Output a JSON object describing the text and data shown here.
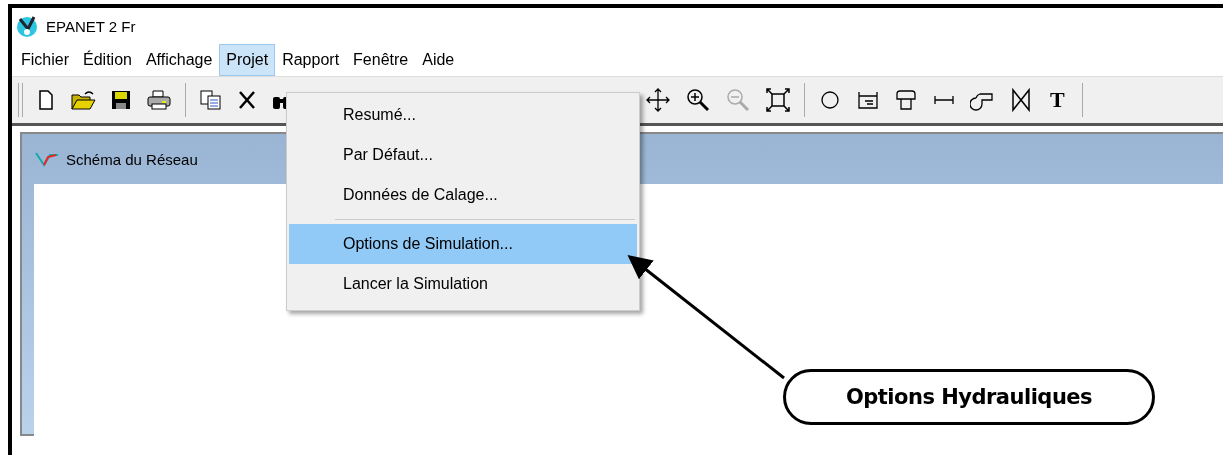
{
  "window": {
    "title": "EPANET 2 Fr"
  },
  "menu_bar": [
    {
      "label": "Fichier",
      "selected": false
    },
    {
      "label": "Édition",
      "selected": false
    },
    {
      "label": "Affichage",
      "selected": false
    },
    {
      "label": "Projet",
      "selected": true
    },
    {
      "label": "Rapport",
      "selected": false
    },
    {
      "label": "Fenêtre",
      "selected": false
    },
    {
      "label": "Aide",
      "selected": false
    }
  ],
  "toolbar": [
    {
      "kind": "new",
      "disabled": false
    },
    {
      "kind": "open",
      "disabled": false
    },
    {
      "kind": "save",
      "disabled": false
    },
    {
      "kind": "print",
      "disabled": false
    },
    {
      "kind": "sep"
    },
    {
      "kind": "copy",
      "disabled": false
    },
    {
      "kind": "delete",
      "disabled": false
    },
    {
      "kind": "find",
      "disabled": false
    },
    {
      "kind": "gap"
    },
    {
      "kind": "pan",
      "disabled": false
    },
    {
      "kind": "zoomin",
      "disabled": false
    },
    {
      "kind": "zoomout",
      "disabled": true
    },
    {
      "kind": "extent",
      "disabled": false
    },
    {
      "kind": "sep"
    },
    {
      "kind": "junction",
      "disabled": false
    },
    {
      "kind": "reservoir",
      "disabled": false
    },
    {
      "kind": "tank",
      "disabled": false
    },
    {
      "kind": "pipe",
      "disabled": false
    },
    {
      "kind": "pump",
      "disabled": false
    },
    {
      "kind": "valve",
      "disabled": false
    },
    {
      "kind": "label",
      "text": "T",
      "disabled": false
    }
  ],
  "child_window": {
    "title": "Schéma du Réseau"
  },
  "dropdown": [
    {
      "kind": "item",
      "label": "Resumé...",
      "selected": false
    },
    {
      "kind": "item",
      "label": "Par Défaut...",
      "selected": false
    },
    {
      "kind": "item",
      "label": "Données de Calage...",
      "selected": false
    },
    {
      "kind": "separator"
    },
    {
      "kind": "item",
      "label": "Options de Simulation...",
      "selected": true
    },
    {
      "kind": "item",
      "label": "Lancer la Simulation",
      "selected": false
    }
  ],
  "callout": {
    "text": "Options Hydrauliques"
  }
}
